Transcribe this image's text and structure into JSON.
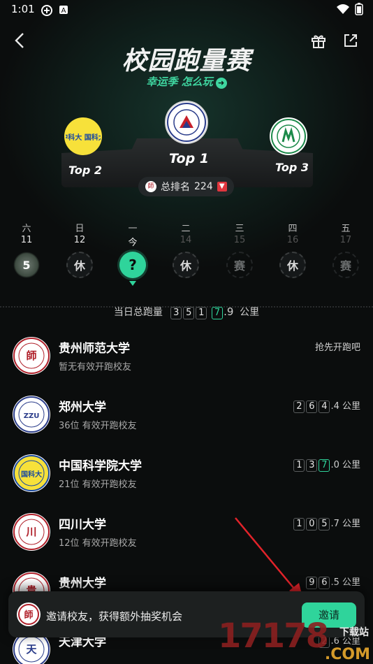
{
  "status_bar": {
    "time": "1:01"
  },
  "header": {
    "title": "校园跑量赛",
    "subtitle": "幸运季 怎么玩"
  },
  "podium": {
    "top1": {
      "label": "Top 1"
    },
    "top2": {
      "label": "Top 2",
      "logo_text": "中科大 国科大"
    },
    "top3": {
      "label": "Top 3"
    }
  },
  "rank_pill": {
    "label": "总排名",
    "value": "224"
  },
  "week": [
    {
      "dow": "六",
      "num": "11",
      "badge": "5",
      "type": "clover"
    },
    {
      "dow": "日",
      "num": "12",
      "badge": "休",
      "type": "rest"
    },
    {
      "dow": "一",
      "num": "今",
      "badge": "?",
      "type": "today"
    },
    {
      "dow": "二",
      "num": "14",
      "badge": "休",
      "type": "rest"
    },
    {
      "dow": "三",
      "num": "15",
      "badge": "赛",
      "type": "race"
    },
    {
      "dow": "四",
      "num": "16",
      "badge": "休",
      "type": "rest"
    },
    {
      "dow": "五",
      "num": "17",
      "badge": "赛",
      "type": "race"
    }
  ],
  "daily_total": {
    "label": "当日总跑量",
    "digits": [
      "3",
      "5",
      "1",
      "7"
    ],
    "decimal": ".9",
    "unit": "公里"
  },
  "universities": [
    {
      "name": "贵州师范大学",
      "sub": "暂无有效开跑校友",
      "right_text": "抢先开跑吧",
      "logo_char": "師"
    },
    {
      "name": "郑州大学",
      "sub": "36位 有效开跑校友",
      "digits": [
        "2",
        "6",
        "4"
      ],
      "decimal": ".4",
      "unit": "公里",
      "logo_char": "ZZU"
    },
    {
      "name": "中国科学院大学",
      "sub": "21位 有效开跑校友",
      "digits": [
        "1",
        "3",
        "7"
      ],
      "decimal": ".0",
      "unit": "公里",
      "logo_char": "国科大"
    },
    {
      "name": "四川大学",
      "sub": "12位 有效开跑校友",
      "digits": [
        "1",
        "0",
        "5"
      ],
      "decimal": ".7",
      "unit": "公里",
      "logo_char": "川"
    },
    {
      "name": "贵州大学",
      "sub": "",
      "digits": [
        "9",
        "6"
      ],
      "decimal": ".5",
      "unit": "公里",
      "logo_char": "貴"
    },
    {
      "name": "天津大学",
      "sub": "",
      "digits": [
        "2"
      ],
      "decimal": ".6",
      "unit": "公里",
      "logo_char": "天"
    }
  ],
  "invite": {
    "text": "邀请校友，获得额外抽奖机会",
    "button": "邀请"
  },
  "watermark": {
    "number": "17178",
    "site": "下载站",
    "domain": ".COM"
  },
  "colors": {
    "accent": "#2fd49b",
    "bg": "#0b0d0d",
    "down": "#e0363e"
  }
}
